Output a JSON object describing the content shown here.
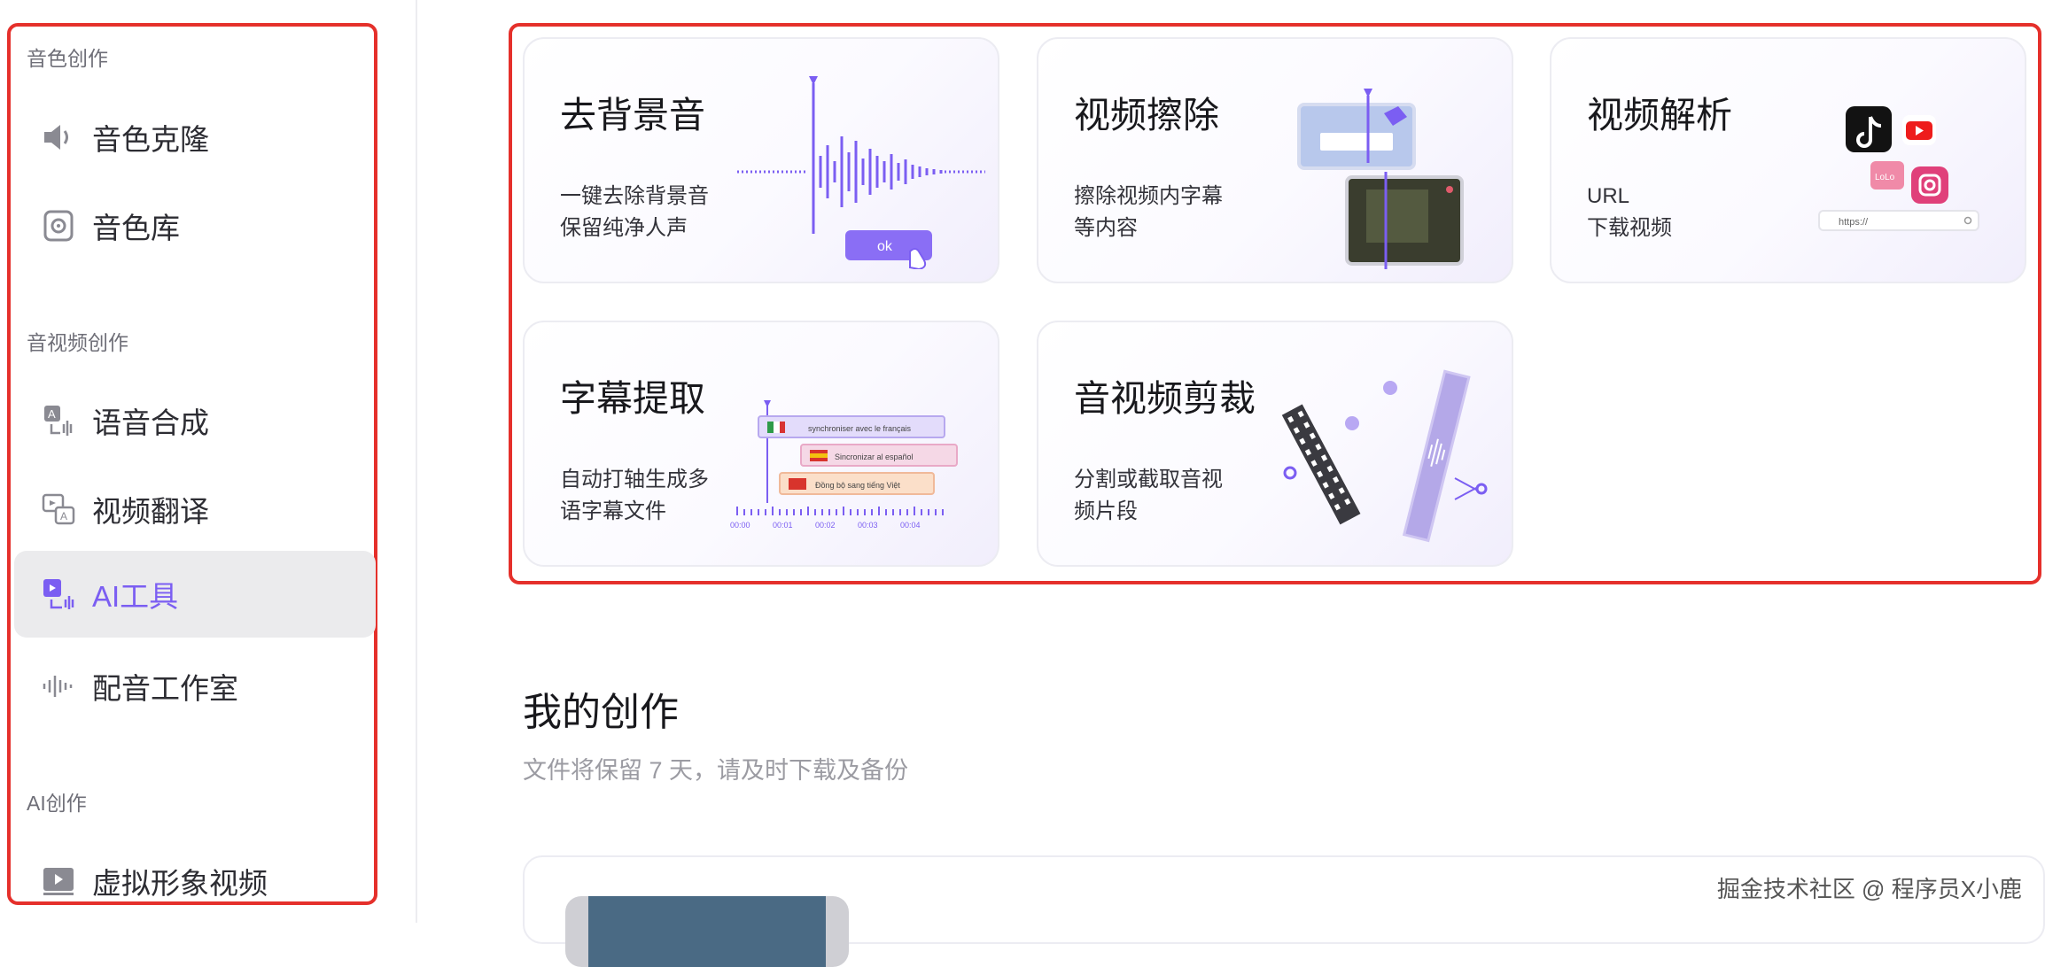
{
  "sidebar": {
    "sections": [
      {
        "label": "音色创作"
      },
      {
        "label": "音视频创作"
      },
      {
        "label": "AI创作"
      }
    ],
    "items": [
      {
        "label": "音色克隆",
        "icon": "speaker-icon"
      },
      {
        "label": "音色库",
        "icon": "disc-icon"
      },
      {
        "label": "语音合成",
        "icon": "text-to-speech-icon"
      },
      {
        "label": "视频翻译",
        "icon": "video-translate-icon"
      },
      {
        "label": "AI工具",
        "icon": "ai-tools-icon",
        "active": true
      },
      {
        "label": "配音工作室",
        "icon": "waveform-icon"
      },
      {
        "label": "虚拟形象视频",
        "icon": "play-icon"
      }
    ]
  },
  "tools": [
    {
      "title": "去背景音",
      "desc": "一键去除背景音 保留纯净人声",
      "art_button": "ok"
    },
    {
      "title": "视频擦除",
      "desc": "擦除视频内字幕 等内容"
    },
    {
      "title": "视频解析",
      "desc": "URL 下载视频",
      "art_url": "https://"
    },
    {
      "title": "字幕提取",
      "desc": "自动打轴生成多 语字幕文件",
      "art_rows": [
        "synchroniser avec le français",
        "Sincronizar al español",
        "Đồng bộ sang tiếng Việt"
      ],
      "art_ticks": [
        "00:00",
        "00:01",
        "00:02",
        "00:03",
        "00:04"
      ]
    },
    {
      "title": "音视频剪裁",
      "desc": "分割或截取音视 频片段"
    }
  ],
  "my_works": {
    "title": "我的创作",
    "subtitle": "文件将保留 7 天，请及时下载及备份"
  },
  "watermark": "掘金技术社区 @ 程序员X小鹿",
  "colors": {
    "accent": "#7b5ef2",
    "highlight_frame": "#e5302b"
  }
}
